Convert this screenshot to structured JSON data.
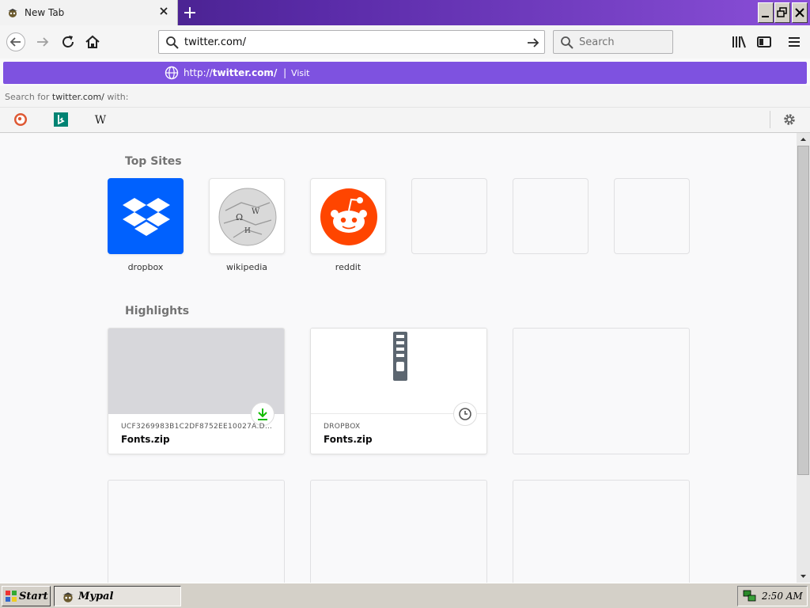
{
  "window": {
    "tab_title": "New Tab",
    "accent": "#7e52e0"
  },
  "toolbar": {
    "url_value": "twitter.com/",
    "search_placeholder": "Search"
  },
  "dropdown": {
    "visit_url_prefix": "http://",
    "visit_url_host": "twitter.com/",
    "visit_separator": "|",
    "visit_label": "Visit",
    "search_for_prefix": "Search for ",
    "search_for_term": "twitter.com/",
    "search_for_suffix": " with:",
    "engines": [
      "duckduckgo-icon",
      "bing-icon",
      "wikipedia-icon"
    ]
  },
  "top_sites": {
    "heading": "Top Sites",
    "tiles": [
      {
        "label": "dropbox",
        "icon": "dropbox-icon"
      },
      {
        "label": "wikipedia",
        "icon": "wikipedia-icon"
      },
      {
        "label": "reddit",
        "icon": "reddit-icon"
      }
    ]
  },
  "highlights": {
    "heading": "Highlights",
    "cards": [
      {
        "context": "UCF3269983B1C2DF8752EE10027A.DL.DR...",
        "title": "Fonts.zip",
        "badge_icon": "download-icon"
      },
      {
        "context": "DROPBOX",
        "title": "Fonts.zip",
        "badge_icon": "clock-icon"
      }
    ]
  },
  "taskbar": {
    "start_label": "Start",
    "app_label": "Mypal",
    "clock": "2:50 AM"
  }
}
